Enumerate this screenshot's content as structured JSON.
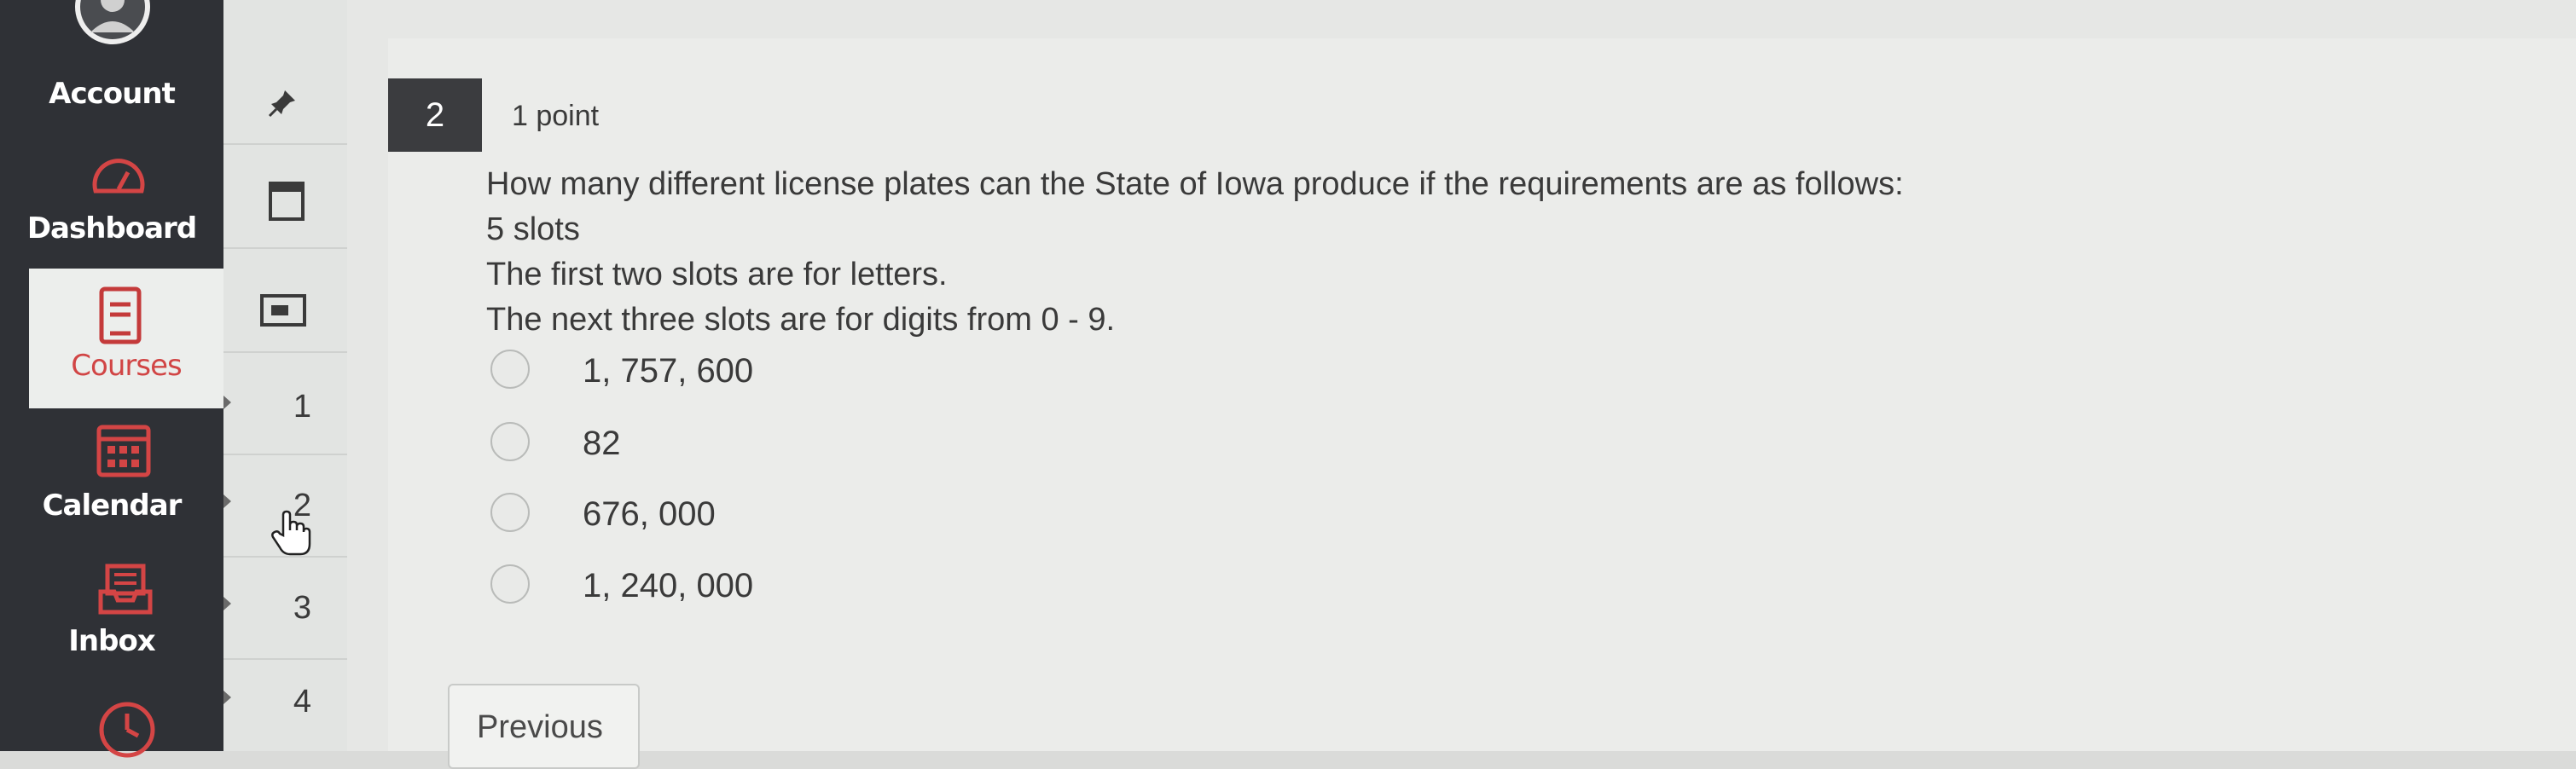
{
  "global_nav": {
    "items": [
      {
        "label": "Account",
        "icon": "user-avatar-icon"
      },
      {
        "label": "Dashboard",
        "icon": "speedometer-icon"
      },
      {
        "label": "Courses",
        "icon": "book-icon",
        "active": true
      },
      {
        "label": "Calendar",
        "icon": "calendar-icon"
      },
      {
        "label": "Inbox",
        "icon": "inbox-icon"
      },
      {
        "label": "",
        "icon": "clock-icon"
      }
    ]
  },
  "course_nav": {
    "questions": [
      "1",
      "2",
      "3",
      "4"
    ]
  },
  "question": {
    "number": "2",
    "points": "1 point",
    "lines": [
      "How many different license plates can the State of Iowa produce if the requirements are as follows:",
      "5 slots",
      "The first two slots are for letters.",
      "The next three slots are for digits from 0 - 9."
    ],
    "options": [
      "1, 757, 600",
      "82",
      "676, 000",
      "1, 240, 000"
    ]
  },
  "footer": {
    "previous_label": "Previous"
  },
  "colors": {
    "nav_bg": "#2f3136",
    "question_badge": "#3b3c3f"
  }
}
